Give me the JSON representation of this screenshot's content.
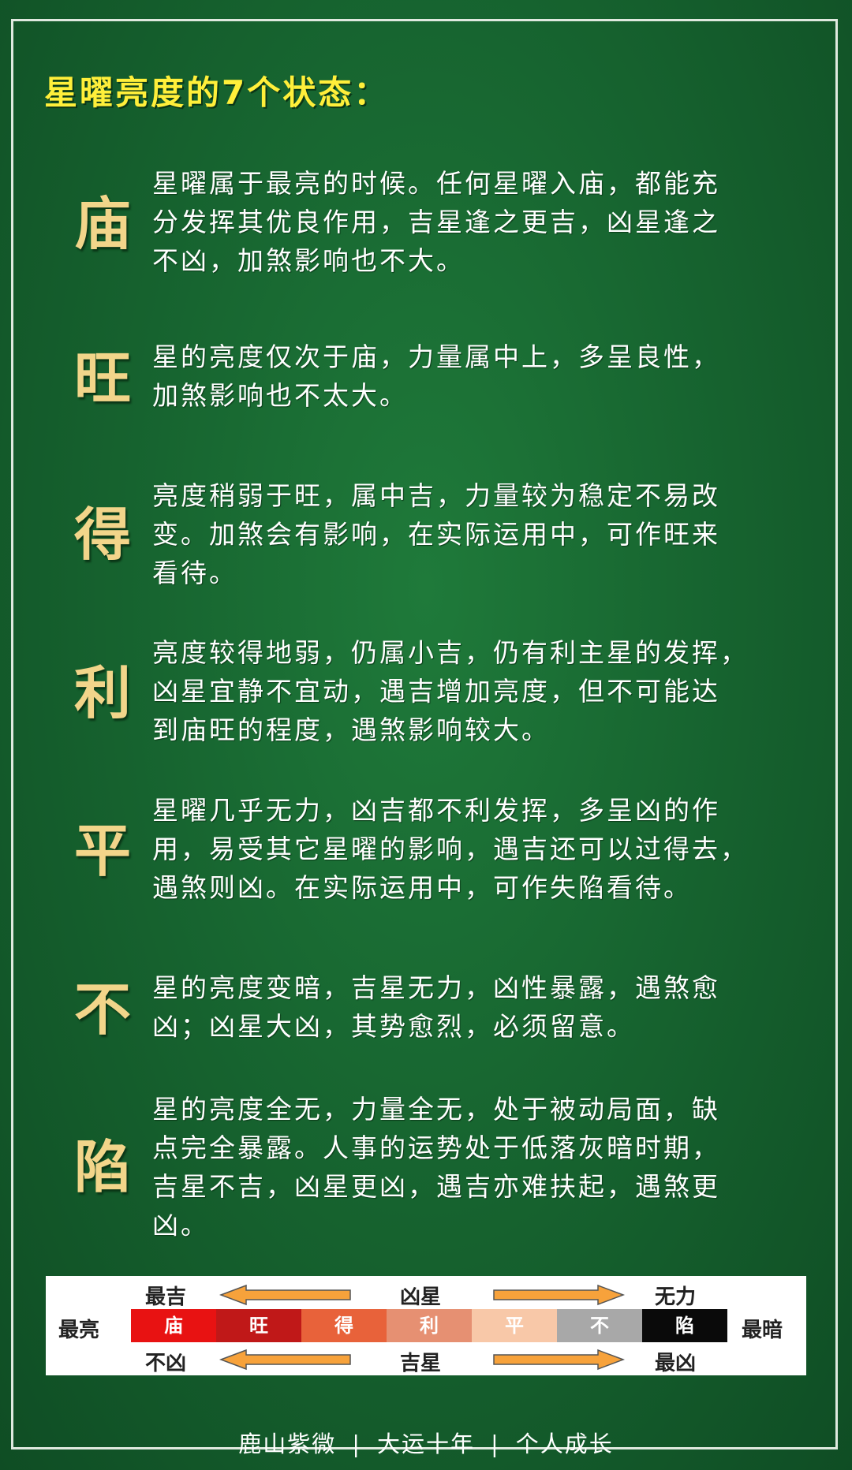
{
  "title": "星曜亮度的7个状态：",
  "states": [
    {
      "char": "庙",
      "lines": [
        "星曜属于最亮的时候。任何星曜入庙，都能充",
        "分发挥其优良作用，吉星逢之更吉，凶星逢之",
        "不凶，加煞影响也不大。"
      ]
    },
    {
      "char": "旺",
      "lines": [
        "星的亮度仅次于庙，力量属中上，多呈良性，",
        "加煞影响也不太大。"
      ]
    },
    {
      "char": "得",
      "lines": [
        "亮度稍弱于旺，属中吉，力量较为稳定不易改",
        "变。加煞会有影响，在实际运用中，可作旺来",
        "看待。"
      ]
    },
    {
      "char": "利",
      "lines": [
        "亮度较得地弱，仍属小吉，仍有利主星的发挥，",
        "凶星宜静不宜动，遇吉增加亮度，但不可能达",
        "到庙旺的程度，遇煞影响较大。"
      ]
    },
    {
      "char": "平",
      "lines": [
        "星曜几乎无力，凶吉都不利发挥，多呈凶的作",
        "用，易受其它星曜的影响，遇吉还可以过得去，",
        "遇煞则凶。在实际运用中，可作失陷看待。"
      ]
    },
    {
      "char": "不",
      "lines": [
        "星的亮度变暗，吉星无力，凶性暴露，遇煞愈",
        "凶；凶星大凶，其势愈烈，必须留意。"
      ]
    },
    {
      "char": "陷",
      "lines": [
        "星的亮度全无，力量全无，处于被动局面，缺",
        "点完全暴露。人事的运势处于低落灰暗时期，",
        "吉星不吉，凶星更凶，遇吉亦难扶起，遇煞更",
        "凶。"
      ]
    }
  ],
  "scale": {
    "left_label": "最亮",
    "right_label": "最暗",
    "top_labels": [
      "最吉",
      "凶星",
      "无力"
    ],
    "bottom_labels": [
      "不凶",
      "吉星",
      "最凶"
    ],
    "segments": [
      {
        "label": "庙",
        "color": "#e81212",
        "text_color": "#ffffff"
      },
      {
        "label": "旺",
        "color": "#c01818",
        "text_color": "#ffffff"
      },
      {
        "label": "得",
        "color": "#e8623a",
        "text_color": "#ffffff"
      },
      {
        "label": "利",
        "color": "#e69072",
        "text_color": "#ffffff"
      },
      {
        "label": "平",
        "color": "#f8c8a8",
        "text_color": "#ffffff"
      },
      {
        "label": "不",
        "color": "#a8a8a8",
        "text_color": "#ffffff"
      },
      {
        "label": "陷",
        "color": "#0a0a0a",
        "text_color": "#ffffff"
      }
    ]
  },
  "footer": {
    "items": [
      "鹿山紫微",
      "大运十年",
      "个人成长"
    ],
    "separator": "|"
  },
  "colors": {
    "title": "#ffef3a",
    "state_char": "#f2d58a",
    "background": "#176530",
    "arrow": "#f7a23b"
  }
}
